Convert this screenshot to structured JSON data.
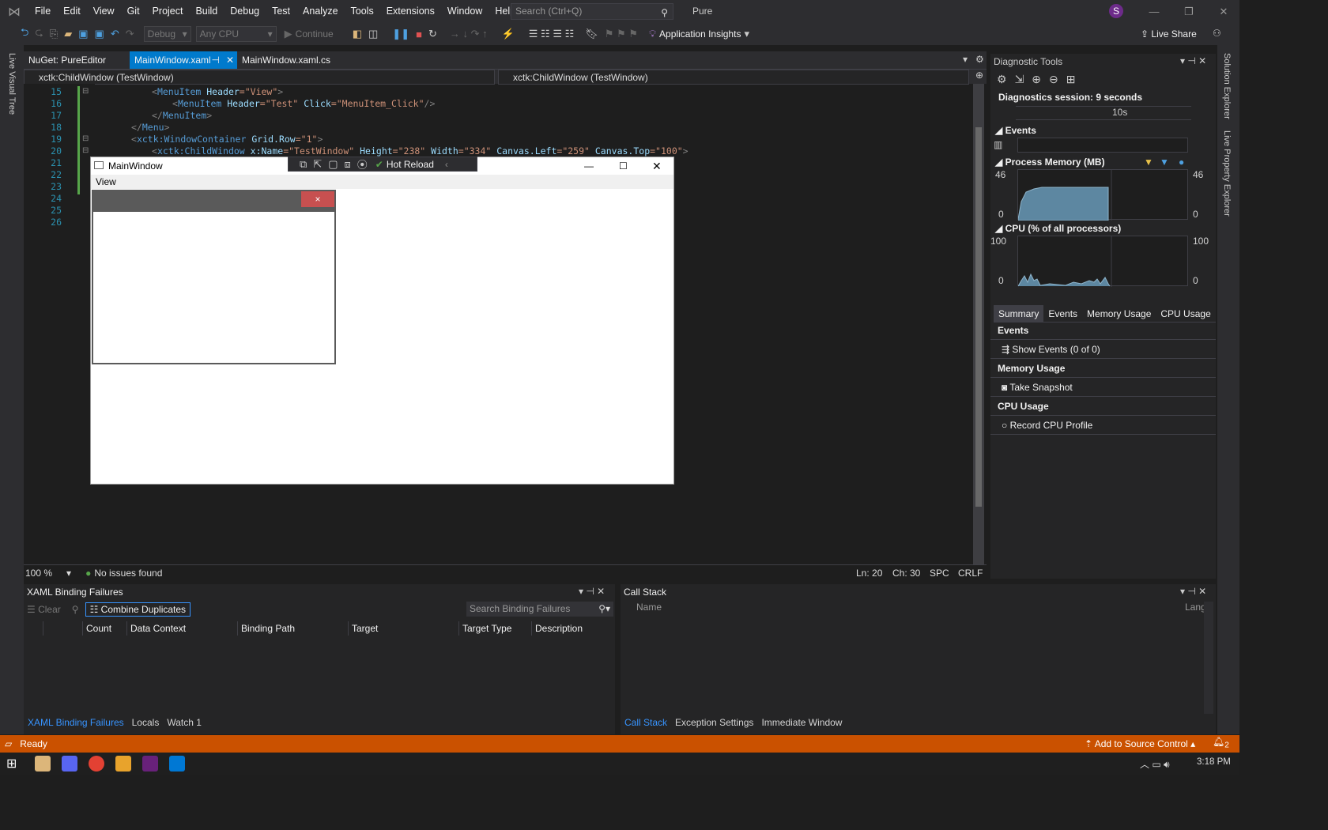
{
  "menu": [
    "File",
    "Edit",
    "View",
    "Git",
    "Project",
    "Build",
    "Debug",
    "Test",
    "Analyze",
    "Tools",
    "Extensions",
    "Window",
    "Help"
  ],
  "search_placeholder": "Search (Ctrl+Q)",
  "solution_name": "Pure",
  "user_initial": "S",
  "toolbar": {
    "config": "Debug",
    "platform": "Any CPU",
    "continue": "Continue",
    "app_insights": "Application Insights",
    "live_share": "Live Share"
  },
  "left_strip": "Live Visual Tree",
  "right_strip": [
    "Solution Explorer",
    "Live Property Explorer"
  ],
  "tabs": [
    {
      "label": "NuGet: PureEditor"
    },
    {
      "label": "MainWindow.xaml",
      "active": true
    },
    {
      "label": "MainWindow.xaml.cs"
    }
  ],
  "nav": {
    "left": "xctk:ChildWindow (TestWindow)",
    "right": "xctk:ChildWindow (TestWindow)"
  },
  "lines": [
    "15",
    "16",
    "17",
    "18",
    "19",
    "20",
    "21",
    "22",
    "23",
    "24",
    "25",
    "26"
  ],
  "code": {
    "l15": [
      "<",
      "MenuItem",
      " Header",
      "=\"View\"",
      ">"
    ],
    "l16": [
      "<",
      "MenuItem",
      " Header",
      "=\"Test\"",
      " Click",
      "=\"MenuItem_Click\"",
      "/>"
    ],
    "l17": [
      "</",
      "MenuItem",
      ">"
    ],
    "l18": [
      "</",
      "Menu",
      ">"
    ],
    "l19": [
      "<",
      "xctk:WindowContainer",
      " Grid.Row",
      "=\"1\"",
      ">"
    ],
    "l20": [
      "<",
      "xctk:ChildWindow",
      " x:Name",
      "=\"TestWindow\"",
      " Height",
      "=\"238\"",
      " Width",
      "=\"334\"",
      " Canvas.Left",
      "=\"259\"",
      " Canvas.Top",
      "=\"100\"",
      ">"
    ]
  },
  "main_window": {
    "title": "MainWindow",
    "menu": "View",
    "close": "×"
  },
  "hot_reload": "Hot Reload",
  "editor_status": {
    "zoom": "100 %",
    "issues": "No issues found",
    "ln": "Ln: 20",
    "ch": "Ch: 30",
    "spc": "SPC",
    "crlf": "CRLF"
  },
  "diag": {
    "title": "Diagnostic Tools",
    "session": "Diagnostics session: 9 seconds",
    "timeline": "10s",
    "events": "Events",
    "memory": "Process Memory (MB)",
    "mem_max": "46",
    "mem_min": "0",
    "cpu": "CPU (% of all processors)",
    "cpu_max": "100",
    "cpu_min": "0",
    "tabs": [
      "Summary",
      "Events",
      "Memory Usage",
      "CPU Usage"
    ],
    "events_head": "Events",
    "show_events": "Show Events (0 of 0)",
    "mem_head": "Memory Usage",
    "snapshot": "Take Snapshot",
    "cpu_head": "CPU Usage",
    "record": "Record CPU Profile"
  },
  "xbf": {
    "title": "XAML Binding Failures",
    "clear": "Clear",
    "combine": "Combine Duplicates",
    "search": "Search Binding Failures",
    "cols": [
      "Count",
      "Data Context",
      "Binding Path",
      "Target",
      "Target Type",
      "Description"
    ],
    "tabs": [
      "XAML Binding Failures",
      "Locals",
      "Watch 1"
    ]
  },
  "callstack": {
    "title": "Call Stack",
    "cols": [
      "Name",
      "Lang"
    ],
    "tabs": [
      "Call Stack",
      "Exception Settings",
      "Immediate Window"
    ]
  },
  "status": {
    "ready": "Ready",
    "source": "Add to Source Control",
    "notif": "2"
  },
  "clock": "3:18 PM"
}
